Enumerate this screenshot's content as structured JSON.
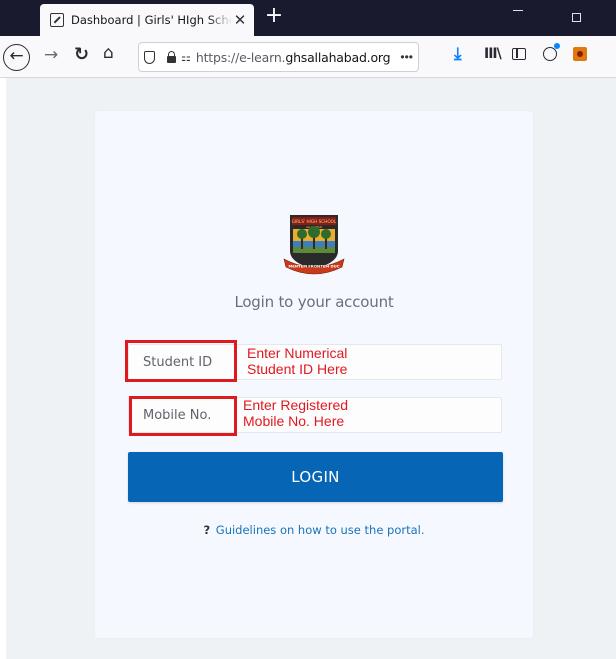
{
  "browser": {
    "tab": {
      "title": "Dashboard | Girls' HIgh School | Allahabad",
      "close": "✕"
    },
    "new_tab": "+",
    "address": {
      "url_prefix": "https://e-learn.",
      "url_domain": "ghsallahabad.org",
      "more": "•••"
    },
    "icons": [
      "favicon-icon",
      "back-arrow-icon",
      "forward-arrow-icon",
      "reload-icon",
      "home-icon",
      "shield-icon",
      "lock-icon",
      "permissions-icon",
      "download-icon",
      "library-icon",
      "sidebar-icon",
      "account-icon",
      "extension-icon"
    ],
    "download_color": "#0a84ff"
  },
  "page": {
    "logo": {
      "top_text": "GIRLS' HIGH SCHOOL",
      "sub_text": "ALLAHABAD",
      "motto": "MENTEM FRONTEM DUC"
    },
    "heading": "Login to your account",
    "student_id": {
      "placeholder": "Student ID",
      "value": ""
    },
    "mobile": {
      "placeholder": "Mobile No.",
      "value": ""
    },
    "annotations": {
      "student_id": [
        "Enter Numerical",
        "Student ID Here"
      ],
      "mobile": [
        "Enter Registered",
        "Mobile No. Here"
      ],
      "color": "#e0191f"
    },
    "login_button": "LOGIN",
    "guidelines": {
      "icon": "?",
      "link": "Guidelines on how to use the portal."
    },
    "colors": {
      "primary": "#0765b5",
      "link": "#1a73b8",
      "card": "#f5f9ff",
      "background": "#eff2f5"
    }
  }
}
